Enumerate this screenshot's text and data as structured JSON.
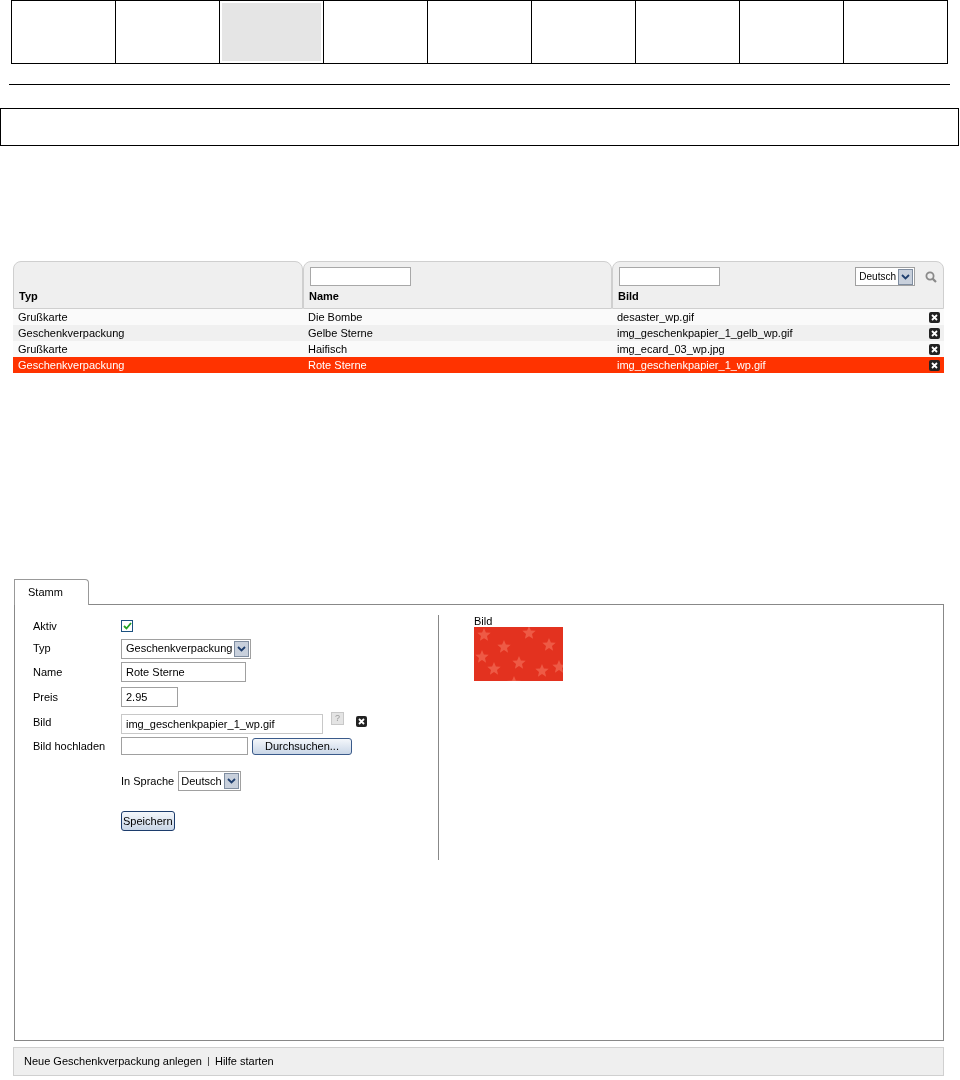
{
  "nav_tabs": [
    {
      "selected": false
    },
    {
      "selected": false
    },
    {
      "selected": true
    },
    {
      "selected": false
    },
    {
      "selected": false
    },
    {
      "selected": false
    },
    {
      "selected": false
    },
    {
      "selected": false
    },
    {
      "selected": false
    }
  ],
  "table": {
    "columns": [
      {
        "label": "Typ",
        "filter": false
      },
      {
        "label": "Name",
        "filter": true
      },
      {
        "label": "Bild",
        "filter": true
      }
    ],
    "language": "Deutsch",
    "rows": [
      {
        "cells": [
          "Grußkarte",
          "Die Bombe",
          "desaster_wp.gif"
        ],
        "selected": false
      },
      {
        "cells": [
          "Geschenkverpackung",
          "Gelbe Sterne",
          "img_geschenkpapier_1_gelb_wp.gif"
        ],
        "selected": false
      },
      {
        "cells": [
          "Grußkarte",
          "Haifisch",
          "img_ecard_03_wp.jpg"
        ],
        "selected": false
      },
      {
        "cells": [
          "Geschenkverpackung",
          "Rote Sterne",
          "img_geschenkpapier_1_wp.gif"
        ],
        "selected": true
      }
    ]
  },
  "detail": {
    "tabs": [
      {
        "label": "Stamm",
        "selected": true
      }
    ],
    "form": [
      {
        "kind": "checkbox",
        "label": "Aktiv",
        "checked": true
      },
      {
        "kind": "select",
        "label": "Typ",
        "value": "Geschenkverpackung"
      },
      {
        "kind": "text",
        "label": "Name",
        "value": "Rote Sterne"
      },
      {
        "kind": "text",
        "label": "Preis",
        "value": "2.95"
      },
      {
        "label": "Bild",
        "value": "img_geschenkpapier_1_wp.gif",
        "help": "?"
      },
      {
        "kind": "upload",
        "label": "Bild hochladen",
        "button": "Durchsuchen..."
      }
    ],
    "language_label": "In Sprache",
    "language": "Deutsch",
    "save": "Speichern",
    "preview_label": "Bild"
  },
  "footer": {
    "links": [
      "Neue Geschenkverpackung anlegen",
      "Hilfe starten"
    ]
  }
}
